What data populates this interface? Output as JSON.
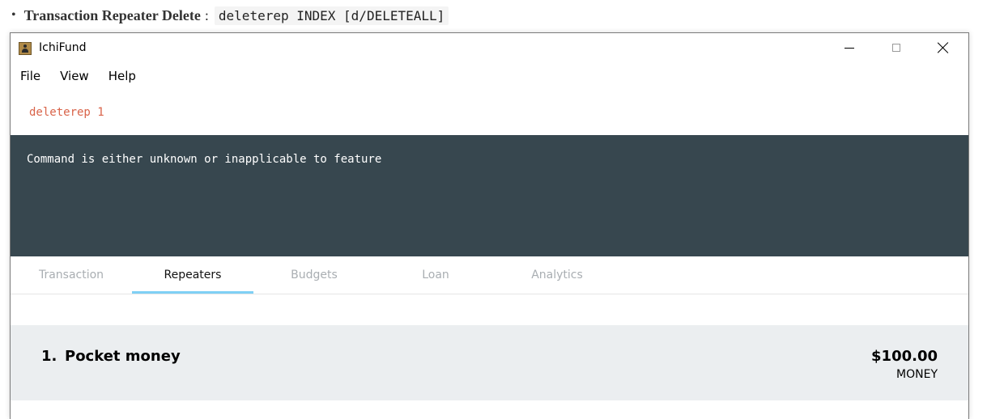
{
  "doc": {
    "bullet": "•",
    "feature_name": "Transaction Repeater Delete",
    "colon": ":",
    "code_command": "deleterep",
    "code_args": " INDEX [d/DELETEALL]"
  },
  "window": {
    "title": "IchiFund",
    "icon": "contact-book-icon",
    "controls": [
      "minimize-icon",
      "maximize-icon",
      "close-icon"
    ]
  },
  "menu": {
    "items": [
      {
        "label": "File"
      },
      {
        "label": "View"
      },
      {
        "label": "Help"
      }
    ]
  },
  "command_box": {
    "value": "deleterep 1",
    "text_color": "#d9644a"
  },
  "result_display": {
    "message": "Command is either unknown or inapplicable to feature",
    "background": "#37474f"
  },
  "tabs": {
    "items": [
      {
        "label": "Transaction",
        "active": false
      },
      {
        "label": "Repeaters",
        "active": true
      },
      {
        "label": "Budgets",
        "active": false
      },
      {
        "label": "Loan",
        "active": false
      },
      {
        "label": "Analytics",
        "active": false
      }
    ],
    "indicator_color": "#7fd0f5"
  },
  "repeaters": {
    "items": [
      {
        "index": "1.",
        "description": "Pocket money",
        "amount": "$100.00",
        "category": "MONEY"
      }
    ]
  }
}
